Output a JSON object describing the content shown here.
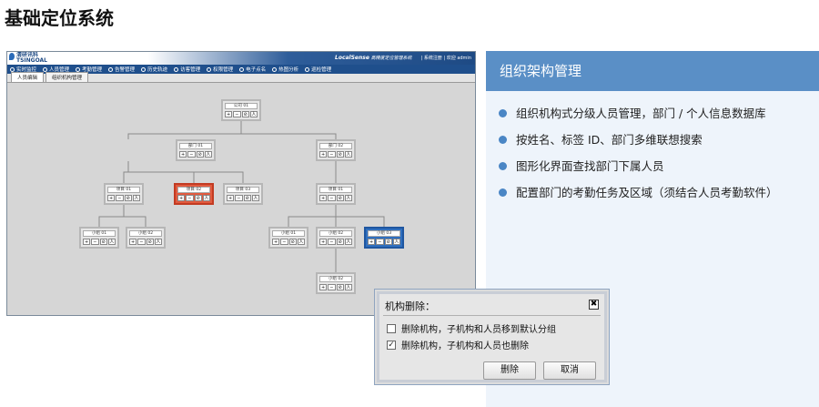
{
  "page_title": "基础定位系统",
  "app": {
    "logo_line1": "清研讯科",
    "logo_line2": "TSINGOAL",
    "brand_bold": "LocalSense",
    "brand_text": "高精度定位管理系统",
    "header_links": "| 系统注册 | 欢迎 admin",
    "menu": [
      "实时监控",
      "人员管理",
      "考勤管理",
      "告警管理",
      "历史轨迹",
      "访客管理",
      "权限管理",
      "电子点名",
      "热图分析",
      "巡检管理"
    ],
    "tabs": [
      "人员编辑",
      "组织机构管理"
    ],
    "nodes": {
      "company": "公司 01",
      "dept1": "部门 01",
      "dept2": "部门 02",
      "proj1": "项目 01",
      "proj2": "项目 02",
      "proj3": "项目 03",
      "proj4": "项目 01",
      "group1": "小组 01",
      "group2": "小组 02",
      "group3": "小组 01",
      "group4": "小组 02",
      "group5": "小组 03",
      "group6": "小组 02"
    },
    "node_buttons": [
      "+",
      "−",
      "⊘",
      "人"
    ]
  },
  "panel": {
    "title": "组织架构管理",
    "bullets": [
      "组织机构式分级人员管理，部门 / 个人信息数据库",
      "按姓名、标签 ID、部门多维联想搜索",
      "图形化界面查找部门下属人员",
      "配置部门的考勤任务及区域（须结合人员考勤软件）"
    ],
    "accent": "#5a8fc6"
  },
  "dialog": {
    "title": "机构删除：",
    "close": "✖",
    "options": [
      {
        "label": "删除机构，子机构和人员移到默认分组",
        "checked": false
      },
      {
        "label": "删除机构，子机构和人员也删除",
        "checked": true
      }
    ],
    "checkmark": "✓",
    "delete_label": "删除",
    "cancel_label": "取消"
  }
}
